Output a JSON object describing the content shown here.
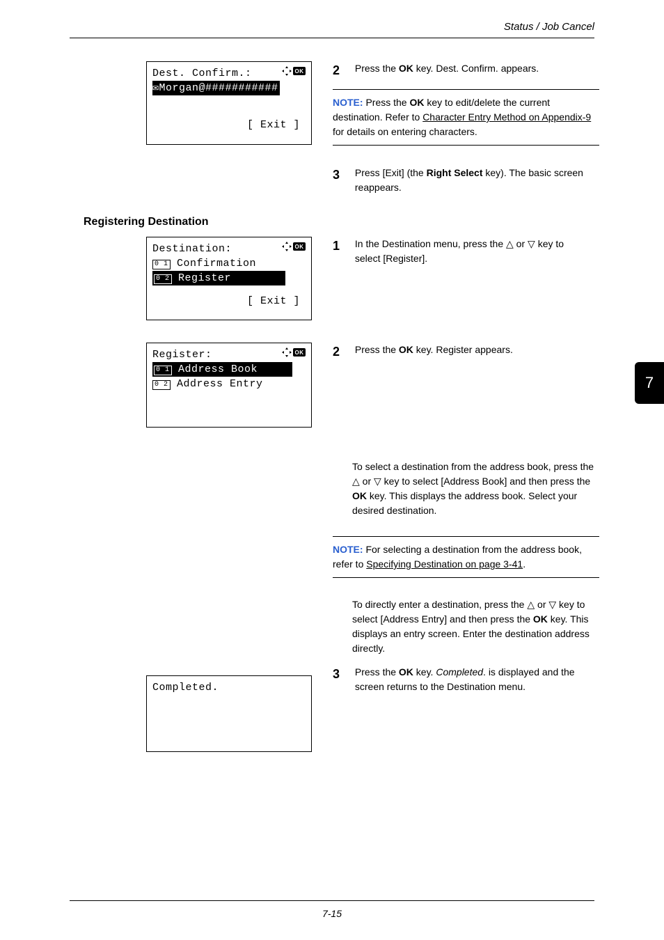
{
  "header": {
    "breadcrumb": "Status / Job Cancel"
  },
  "sideTab": {
    "number": "7"
  },
  "lcd1": {
    "title": "Dest. Confirm.:",
    "highlighted_prefix": "✉",
    "highlighted": "Morgan@###########",
    "exit": "[  Exit  ]"
  },
  "step2a": {
    "num": "2",
    "text_a": "Press the ",
    "bold_a": "OK",
    "text_b": " key. Dest. Confirm. appears."
  },
  "note1": {
    "label": "NOTE: ",
    "text_a": "Press the ",
    "bold": "OK",
    "text_b": " key to edit/delete the current destination. Refer to ",
    "link": "Character Entry Method on Appendix-9",
    "text_c": " for details on entering characters."
  },
  "step3a": {
    "num": "3",
    "text_a": "Press [Exit] (the ",
    "bold": "Right Select",
    "text_b": " key). The basic screen reappears."
  },
  "sectionHeading": "Registering Destination",
  "lcd2": {
    "title": "Destination:",
    "row1_num": "0 1",
    "row1_text": " Confirmation",
    "row2_num": "0 2",
    "row2_text": " Register",
    "exit": "[  Exit  ]"
  },
  "step1b": {
    "num": "1",
    "text_a": "In the Destination menu, press the ",
    "tri_up": "△",
    "text_b": " or ",
    "tri_down": "▽",
    "text_c": " key to select [Register]."
  },
  "lcd3": {
    "title": "Register:",
    "row1_num": "0 1",
    "row1_text": " Address Book",
    "row2_num": "0 2",
    "row2_text": " Address Entry"
  },
  "step2b": {
    "num": "2",
    "text_a": "Press the ",
    "bold": "OK",
    "text_b": " key. Register appears."
  },
  "para_addrbook": {
    "text_a": "To select a destination from the address book, press the ",
    "tri_up": "△",
    "text_b": " or ",
    "tri_down": "▽",
    "text_c": " key to select [Address Book] and then press the ",
    "bold": "OK",
    "text_d": " key. This displays the address book. Select your desired destination."
  },
  "note2": {
    "label": "NOTE: ",
    "text_a": "For selecting a destination from the address book, refer to ",
    "link": "Specifying Destination on page 3-41",
    "text_b": "."
  },
  "para_entry": {
    "text_a": "To directly enter a destination, press the ",
    "tri_up": "△",
    "text_b": " or ",
    "tri_down": "▽",
    "text_c": " key to select [Address Entry] and then press the ",
    "bold": "OK",
    "text_d": " key. This displays an entry screen. Enter the destination address directly."
  },
  "step3b": {
    "num": "3",
    "text_a": "Press the ",
    "bold": "OK",
    "text_b": " key. ",
    "ital": "Completed",
    "text_c": ". is displayed and the screen returns to the Destination menu."
  },
  "lcd4": {
    "text": "Completed."
  },
  "footer": {
    "page": "7-15"
  }
}
